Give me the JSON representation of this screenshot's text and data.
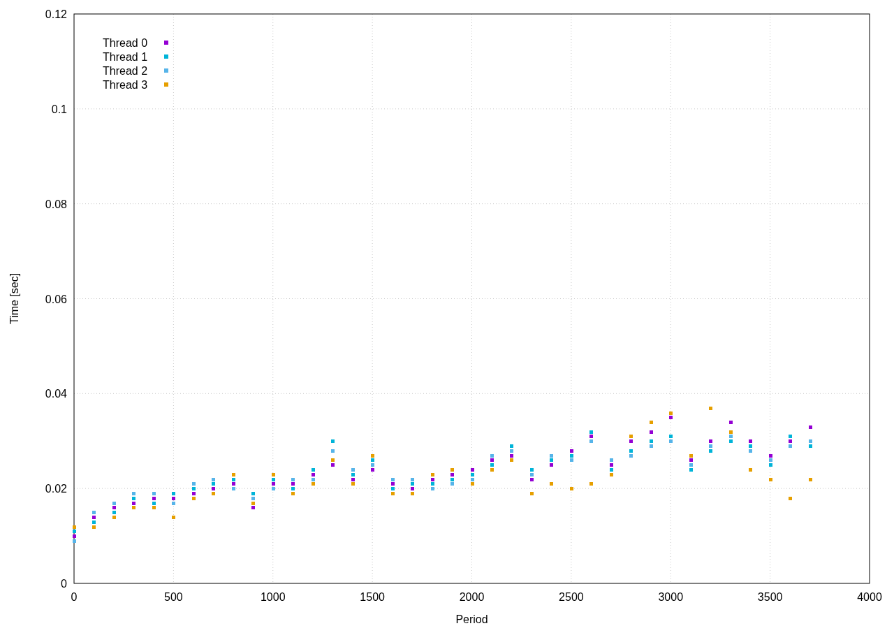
{
  "chart_data": {
    "type": "scatter",
    "grid": true,
    "legend": true,
    "xlabel": "Period",
    "ylabel": "Time [sec]",
    "xlim": [
      0,
      4000
    ],
    "ylim": [
      0,
      0.12
    ],
    "xticks": [
      0,
      500,
      1000,
      1500,
      2000,
      2500,
      3000,
      3500,
      4000
    ],
    "yticks": [
      0,
      {
        "value": 0.02,
        "label": "0.02"
      },
      {
        "value": 0.04,
        "label": "0.04"
      },
      {
        "value": 0.06,
        "label": "0.06"
      },
      {
        "value": 0.08,
        "label": "0.08"
      },
      {
        "value": 0.1,
        "label": "0.1"
      },
      {
        "value": 0.12,
        "label": "0.12"
      }
    ],
    "x": [
      0,
      100,
      200,
      300,
      400,
      500,
      600,
      700,
      800,
      900,
      1000,
      1100,
      1200,
      1300,
      1400,
      1500,
      1600,
      1700,
      1800,
      1900,
      2000,
      2100,
      2200,
      2300,
      2400,
      2500,
      2600,
      2700,
      2800,
      2900,
      3000,
      3100,
      3200,
      3300,
      3400,
      3500,
      3600,
      3700
    ],
    "series": [
      {
        "name": "Thread 0",
        "color": "#9400d3",
        "values": [
          0.01,
          0.014,
          0.016,
          0.017,
          0.018,
          0.018,
          0.019,
          0.02,
          0.021,
          0.016,
          0.021,
          0.021,
          0.023,
          0.025,
          0.022,
          0.024,
          0.021,
          0.02,
          0.022,
          0.023,
          0.024,
          0.026,
          0.027,
          0.022,
          0.025,
          0.028,
          0.031,
          0.025,
          0.03,
          0.032,
          0.035,
          0.026,
          0.03,
          0.034,
          0.03,
          0.027,
          0.03,
          0.033
        ]
      },
      {
        "name": "Thread 1",
        "color": "#00b4d8",
        "values": [
          0.011,
          0.013,
          0.015,
          0.018,
          0.017,
          0.019,
          0.02,
          0.021,
          0.022,
          0.019,
          0.022,
          0.02,
          0.024,
          0.03,
          0.023,
          0.026,
          0.02,
          0.021,
          0.021,
          0.022,
          0.023,
          0.025,
          0.029,
          0.024,
          0.026,
          0.027,
          0.032,
          0.024,
          0.028,
          0.03,
          0.031,
          0.024,
          0.028,
          0.03,
          0.029,
          0.025,
          0.031,
          0.029
        ]
      },
      {
        "name": "Thread 2",
        "color": "#56b4e9",
        "values": [
          0.009,
          0.015,
          0.017,
          0.019,
          0.019,
          0.017,
          0.021,
          0.022,
          0.02,
          0.018,
          0.02,
          0.022,
          0.022,
          0.028,
          0.024,
          0.025,
          0.022,
          0.022,
          0.02,
          0.021,
          0.022,
          0.027,
          0.028,
          0.023,
          0.027,
          0.026,
          0.03,
          0.026,
          0.027,
          0.029,
          0.03,
          0.025,
          0.029,
          0.031,
          0.028,
          0.026,
          0.029,
          0.03
        ]
      },
      {
        "name": "Thread 3",
        "color": "#e69f00",
        "values": [
          0.012,
          0.012,
          0.014,
          0.016,
          0.016,
          0.014,
          0.018,
          0.019,
          0.023,
          0.017,
          0.023,
          0.019,
          0.021,
          0.026,
          0.021,
          0.027,
          0.019,
          0.019,
          0.023,
          0.024,
          0.021,
          0.024,
          0.026,
          0.019,
          0.021,
          0.02,
          0.021,
          0.023,
          0.031,
          0.034,
          0.036,
          0.027,
          0.037,
          0.032,
          0.024,
          0.022,
          0.018,
          0.022
        ]
      }
    ]
  }
}
